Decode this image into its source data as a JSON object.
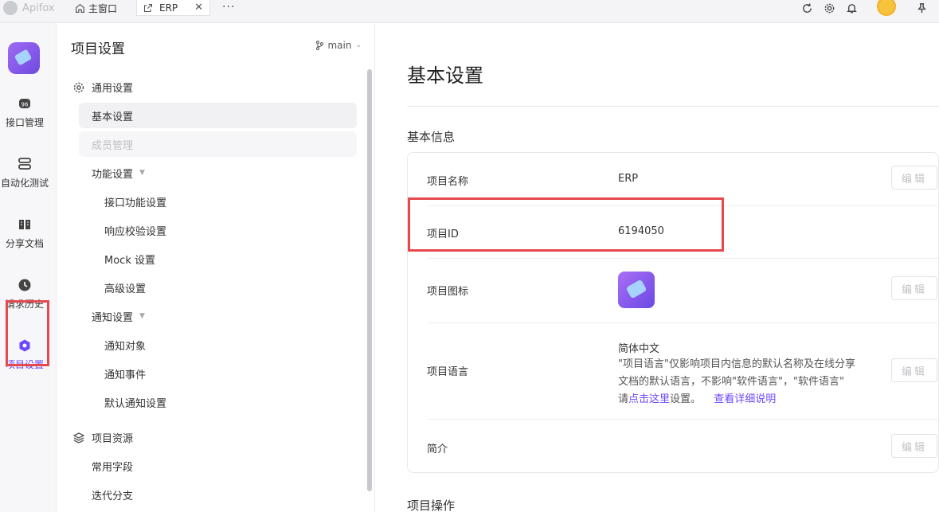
{
  "topbar": {
    "brand": "Apifox",
    "home_tab": "主窗口",
    "active_tab": "ERP",
    "more": "···",
    "icons": [
      "refresh-icon",
      "gear-icon",
      "bell-icon",
      "avatar",
      "pin-icon"
    ]
  },
  "rail": {
    "items": [
      {
        "label": "接口管理",
        "icon": "api-icon"
      },
      {
        "label": "自动化测试",
        "icon": "automation-icon"
      },
      {
        "label": "分享文档",
        "icon": "book-icon"
      },
      {
        "label": "请求历史",
        "icon": "clock-icon"
      },
      {
        "label": "项目设置",
        "icon": "settings-hex-icon",
        "active": true
      }
    ]
  },
  "sidebar": {
    "title": "项目设置",
    "branch": "main",
    "general_section": "通用设置",
    "basic_settings": "基本设置",
    "member_management": "成员管理",
    "feature_settings": "功能设置",
    "api_feature_settings": "接口功能设置",
    "response_validation_settings": "响应校验设置",
    "mock_settings": "Mock 设置",
    "advanced_settings": "高级设置",
    "notify_settings": "通知设置",
    "notify_target": "通知对象",
    "notify_event": "通知事件",
    "default_notify_settings": "默认通知设置",
    "resources_section": "项目资源",
    "common_fields": "常用字段",
    "iteration_branch": "迭代分支"
  },
  "main": {
    "title": "基本设置",
    "basic_info_title": "基本信息",
    "edit_label": "编辑",
    "rows": {
      "name": {
        "label": "项目名称",
        "value": "ERP"
      },
      "id": {
        "label": "项目ID",
        "value": "6194050"
      },
      "icon": {
        "label": "项目图标"
      },
      "language": {
        "label": "项目语言",
        "value": "简体中文",
        "desc_1": "\"项目语言\"仅影响项目内信息的默认名称及在线分享文档的默认语言，不影响\"软件语言\"，\"软件语言\" 请",
        "link_here": "点击这里",
        "desc_2": "设置。",
        "link_more": "查看详细说明"
      },
      "intro": {
        "label": "简介"
      }
    },
    "project_ops_title": "项目操作"
  }
}
